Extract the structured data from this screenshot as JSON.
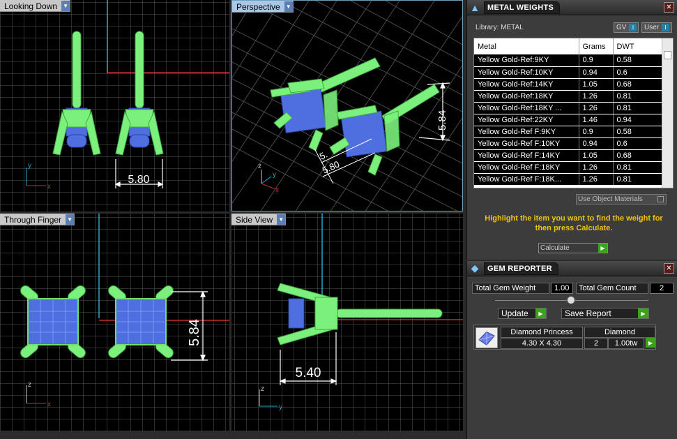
{
  "viewports": {
    "top": {
      "label": "Looking Down",
      "dimension": "5.80"
    },
    "perspective": {
      "label": "Perspective",
      "dimension_height": "5.84",
      "dimension_a": "5.",
      "dimension_b": "5.80"
    },
    "front": {
      "label": "Through Finger",
      "dimension": "5.84"
    },
    "side": {
      "label": "Side View",
      "dimension": "5.40"
    },
    "axes": {
      "x": "x",
      "y": "y",
      "z": "z"
    }
  },
  "metal_panel": {
    "title": "METAL WEIGHTS",
    "library_label": "Library: METAL",
    "gv_label": "GV",
    "user_label": "User",
    "toggle_glyph": "I",
    "columns": [
      "Metal",
      "Grams",
      "DWT"
    ],
    "rows": [
      [
        "Yellow Gold-Ref:9KY",
        "0.9",
        "0.58"
      ],
      [
        "Yellow Gold-Ref:10KY",
        "0.94",
        "0.6"
      ],
      [
        "Yellow Gold-Ref:14KY",
        "1.05",
        "0.68"
      ],
      [
        "Yellow Gold-Ref:18KY",
        "1.26",
        "0.81"
      ],
      [
        "Yellow Gold-Ref:18KY ...",
        "1.26",
        "0.81"
      ],
      [
        "Yellow Gold-Ref:22KY",
        "1.46",
        "0.94"
      ],
      [
        "Yellow Gold-Ref F:9KY",
        "0.9",
        "0.58"
      ],
      [
        "Yellow Gold-Ref F:10KY",
        "0.94",
        "0.6"
      ],
      [
        "Yellow Gold-Ref F:14KY",
        "1.05",
        "0.68"
      ],
      [
        "Yellow Gold-Ref F:18KY",
        "1.26",
        "0.81"
      ],
      [
        "Yellow Gold-Ref F:18K...",
        "1.26",
        "0.81"
      ]
    ],
    "use_object_materials": "Use Object Materials",
    "highlight_message": "Highlight the item you want to find the weight for then press Calculate.",
    "calculate_label": "Calculate",
    "close_glyph": "✕",
    "icon_glyph": "▲"
  },
  "gem_panel": {
    "title": "GEM REPORTER",
    "total_gem_weight_label": "Total Gem Weight",
    "total_gem_weight": "1.00",
    "total_gem_count_label": "Total Gem Count",
    "total_gem_count": "2",
    "update_label": "Update",
    "save_report_label": "Save Report",
    "gem": {
      "name": "Diamond Princess",
      "type": "Diamond",
      "size": "4.30 X 4.30",
      "count": "2",
      "weight": "1.00tw"
    },
    "go_glyph": "▶",
    "close_glyph": "✕",
    "icon_glyph": "◆"
  },
  "colors": {
    "grid": "#3a3a3a",
    "grid_major": "#5a5a5a",
    "metal_green": "#7cf07c",
    "gem_blue": "#4f6fe0",
    "axis_red": "#c03030",
    "axis_cyan": "#2aa3c8",
    "accent_yellow": "#f2c20d"
  }
}
